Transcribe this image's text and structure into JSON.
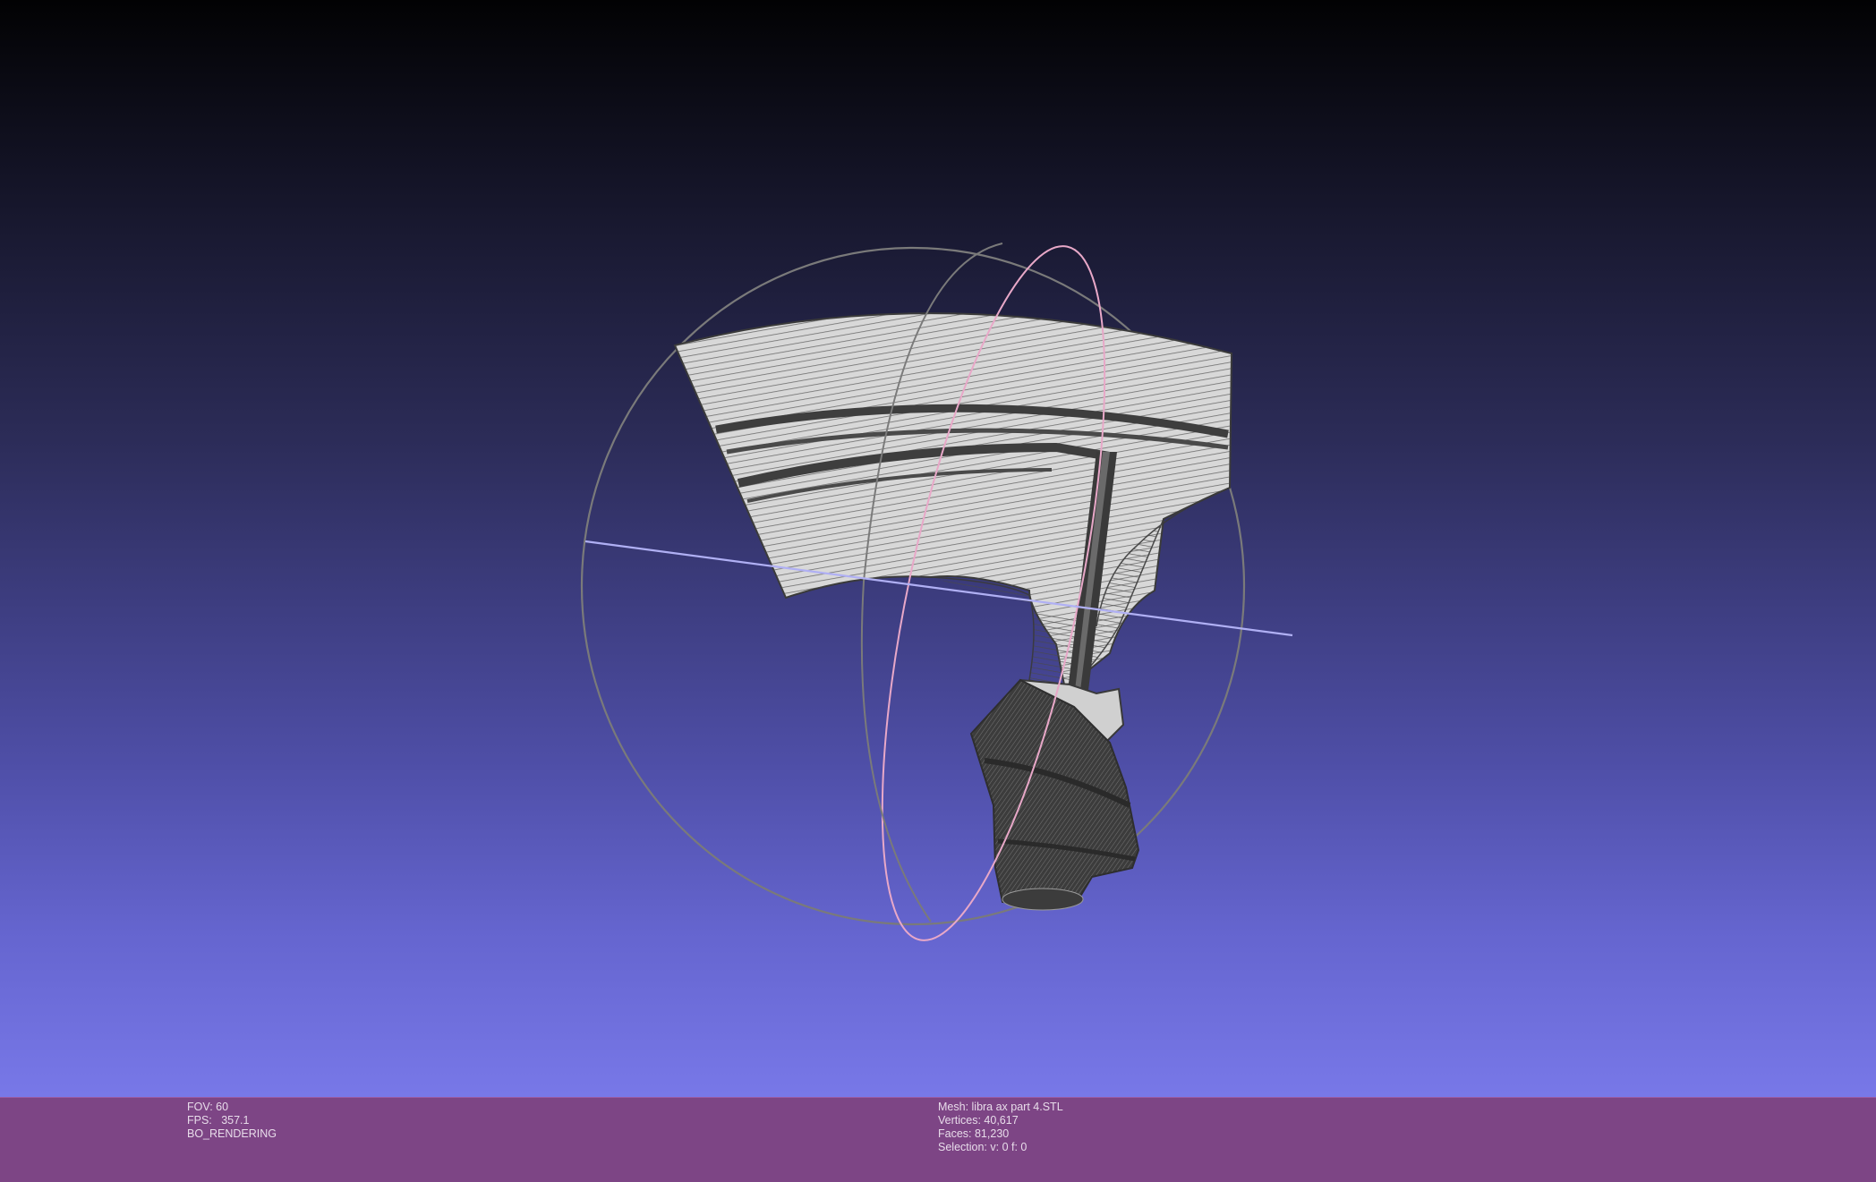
{
  "viewport": {
    "background_top": "#020203",
    "background_bottom": "#7878e8",
    "model_fill": "#d8d8d8",
    "wire_color": "#3a3a3a",
    "trackball_gray": "#7a7a7a",
    "trackball_pink": "#e8a8c8",
    "trackball_blue": "#a8a8f0"
  },
  "status": {
    "background": "#7d4585",
    "fov": "FOV: 60",
    "fps": "FPS:   357.1",
    "rendering": "BO_RENDERING",
    "mesh": "Mesh: libra ax part 4.STL",
    "vertices": "Vertices: 40,617",
    "faces": "Faces: 81,230",
    "selection": "Selection: v: 0 f: 0"
  }
}
